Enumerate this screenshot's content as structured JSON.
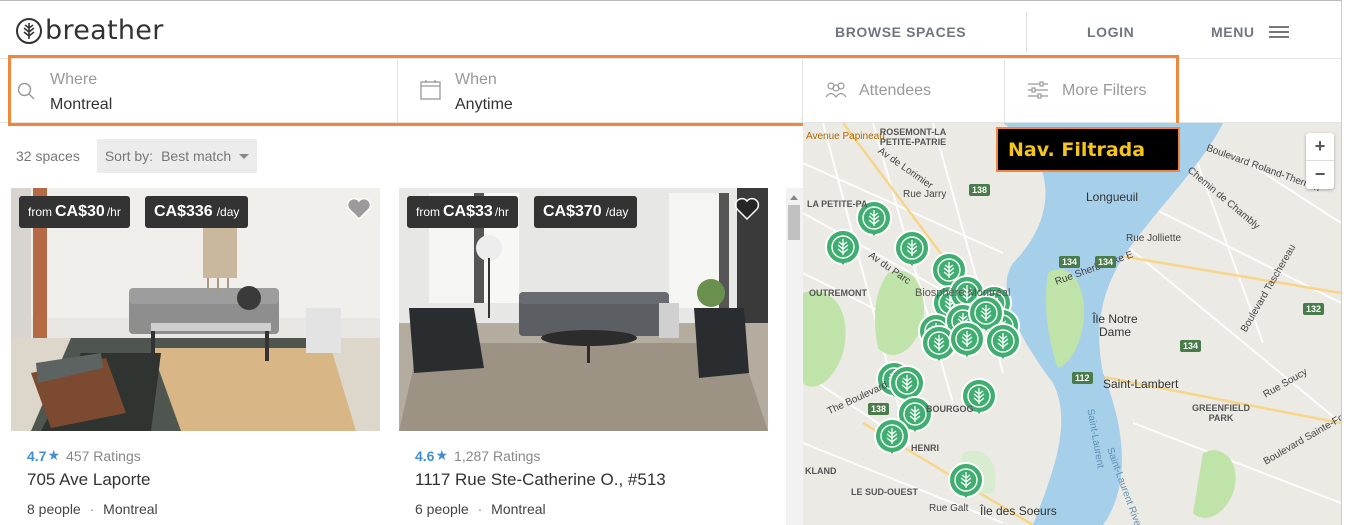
{
  "header": {
    "logo_text": "breather",
    "nav_browse": "BROWSE SPACES",
    "nav_login": "LOGIN",
    "nav_menu": "MENU"
  },
  "filters": {
    "where_label": "Where",
    "where_value": "Montreal",
    "when_label": "When",
    "when_value": "Anytime",
    "attendees_label": "Attendees",
    "more_filters_label": "More Filters"
  },
  "annotation": {
    "text": "Nav. Filtrada"
  },
  "results": {
    "count": "32 spaces",
    "sort_label": "Sort by:",
    "sort_value": "Best match"
  },
  "listings": [
    {
      "price_hr_prefix": "from",
      "price_hr": "CA$30",
      "price_hr_unit": "/hr",
      "price_day": "CA$336",
      "price_day_unit": "/day",
      "rating": "4.7",
      "ratings_count": "457 Ratings",
      "name": "705 Ave Laporte",
      "people": "8 people",
      "city": "Montreal"
    },
    {
      "price_hr_prefix": "from",
      "price_hr": "CA$33",
      "price_hr_unit": "/hr",
      "price_day": "CA$370",
      "price_day_unit": "/day",
      "rating": "4.6",
      "ratings_count": "1,287 Ratings",
      "name": "1117 Rue Ste-Catherine O., #513",
      "people": "6 people",
      "city": "Montreal"
    }
  ],
  "map": {
    "zoom_in": "+",
    "zoom_out": "−",
    "labels": [
      "Longueuil",
      "Île Notre Dame",
      "Saint-Lambert",
      "GREENFIELD PARK",
      "OUTREMONT",
      "LE SUD-OUEST",
      "Île des Soeurs",
      "Avenue Papineau",
      "ROSEMONT-LA PETITE-PATRIE",
      "LA PETITE-PA",
      "Biosphère Montréal",
      "Rue Galt",
      "The Boulevard",
      "Boulevard Roland-Therrien",
      "Chemin de Chambly",
      "Rue Jolliette",
      "Boulevard Taschereau",
      "Rue Soucy",
      "Boulevard Sainte-Foy",
      "Av du Parc",
      "HENRI",
      "BOURGOG",
      "KLAND",
      "Saint-Laurent",
      "Av de Lorimier",
      "Rue Jarry",
      "Rue Sherbrooke E",
      "Saint-Laurent River"
    ],
    "highways": [
      "138",
      "134",
      "134",
      "134",
      "112",
      "138",
      "132"
    ],
    "accent": "#3fae70"
  },
  "colors": {
    "highlight": "#f0873a",
    "annotation_text": "#f5c518",
    "rating_blue": "#3d8fd8",
    "pin_green": "#3fae70",
    "water": "#a6cfea",
    "park": "#bfe3a8"
  }
}
